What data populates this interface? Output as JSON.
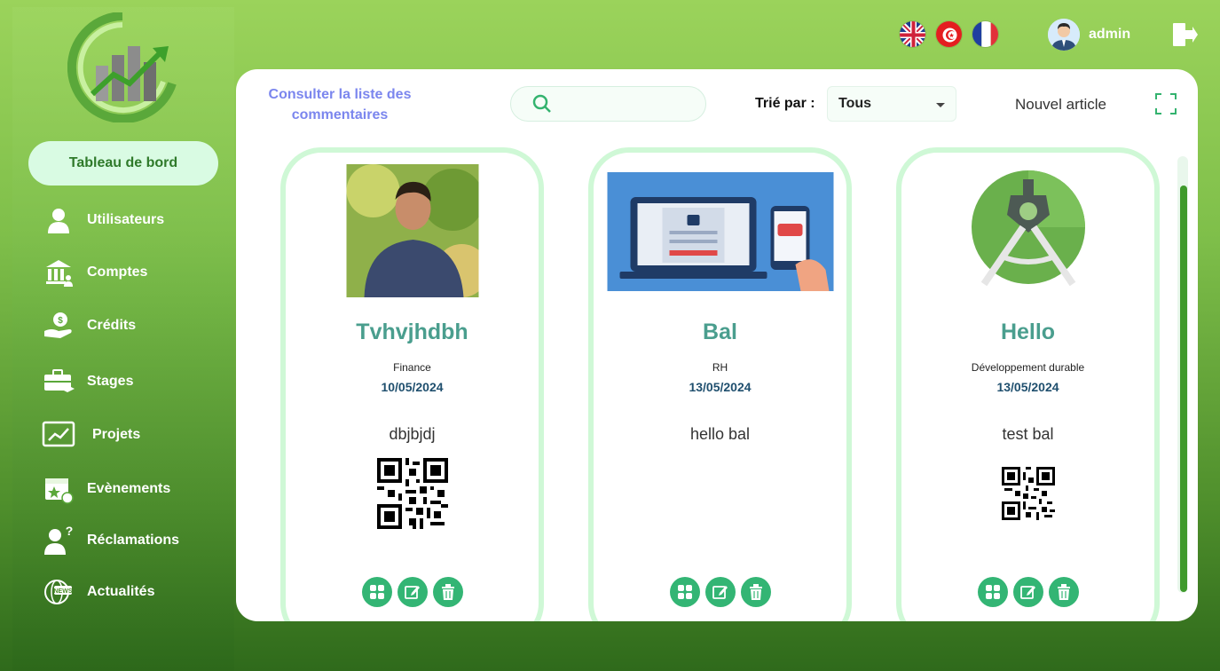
{
  "sidebar": {
    "logo_icon": "chart-growth-logo",
    "dashboard_label": "Tableau de bord",
    "items": [
      {
        "label": "Utilisateurs",
        "icon": "user-icon"
      },
      {
        "label": "Comptes",
        "icon": "bank-icon"
      },
      {
        "label": "Crédits",
        "icon": "credit-hand-icon"
      },
      {
        "label": "Stages",
        "icon": "briefcase-icon"
      },
      {
        "label": "Projets",
        "icon": "chart-board-icon"
      },
      {
        "label": "Evènements",
        "icon": "calendar-star-icon"
      },
      {
        "label": "Réclamations",
        "icon": "user-question-icon"
      },
      {
        "label": "Actualités",
        "icon": "news-globe-icon"
      }
    ]
  },
  "topbar": {
    "languages": [
      "en",
      "tn",
      "fr"
    ],
    "user_name": "admin"
  },
  "panel": {
    "title": "Consulter la liste des commentaires",
    "search_placeholder": "",
    "sort_label": "Trié par :",
    "sort_value": "Tous",
    "new_article_label": "Nouvel article"
  },
  "cards": [
    {
      "name": "Tvhvjhdbh",
      "category": "Finance",
      "date": "10/05/2024",
      "description": "dbjbjdj",
      "has_qr": true,
      "image": "person-photo"
    },
    {
      "name": "Bal",
      "category": "RH",
      "date": "13/05/2024",
      "description": "hello bal",
      "has_qr": false,
      "image": "password-verify-illustration"
    },
    {
      "name": "Hello",
      "category": "Développement durable",
      "date": "13/05/2024",
      "description": "test bal",
      "has_qr": true,
      "image": "android-studio-logo"
    }
  ],
  "colors": {
    "accent_green": "#33b574",
    "card_border": "#cff8d6",
    "title_blue": "#7b86ee",
    "name_teal": "#4a9e8e"
  }
}
